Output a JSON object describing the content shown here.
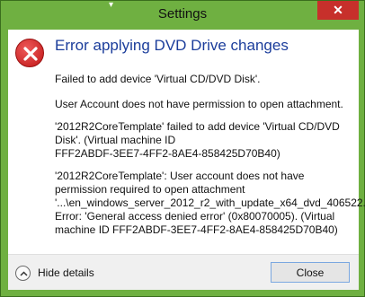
{
  "window": {
    "title": "Settings",
    "close_glyph": "✕"
  },
  "dialog": {
    "icon": "error-icon",
    "heading": "Error applying DVD Drive changes",
    "messages": [
      "Failed to add device 'Virtual CD/DVD Disk'.",
      "User Account does not have permission to open attachment.",
      "'2012R2CoreTemplate' failed to add device 'Virtual CD/DVD\nDisk'. (Virtual machine ID\nFFF2ABDF-3EE7-4FF2-8AE4-858425D70B40)",
      "'2012R2CoreTemplate': User account does not have\npermission required to open attachment\n'...\\en_windows_server_2012_r2_with_update_x64_dvd_406522...\nError: 'General access denied error' (0x80070005). (Virtual\nmachine ID FFF2ABDF-3EE7-4FF2-8AE4-858425D70B40)"
    ]
  },
  "footer": {
    "details_label": "Hide details",
    "close_label": "Close"
  },
  "colors": {
    "frame": "#6fb041",
    "heading": "#1b3d9b",
    "close_x": "#c7302b"
  }
}
